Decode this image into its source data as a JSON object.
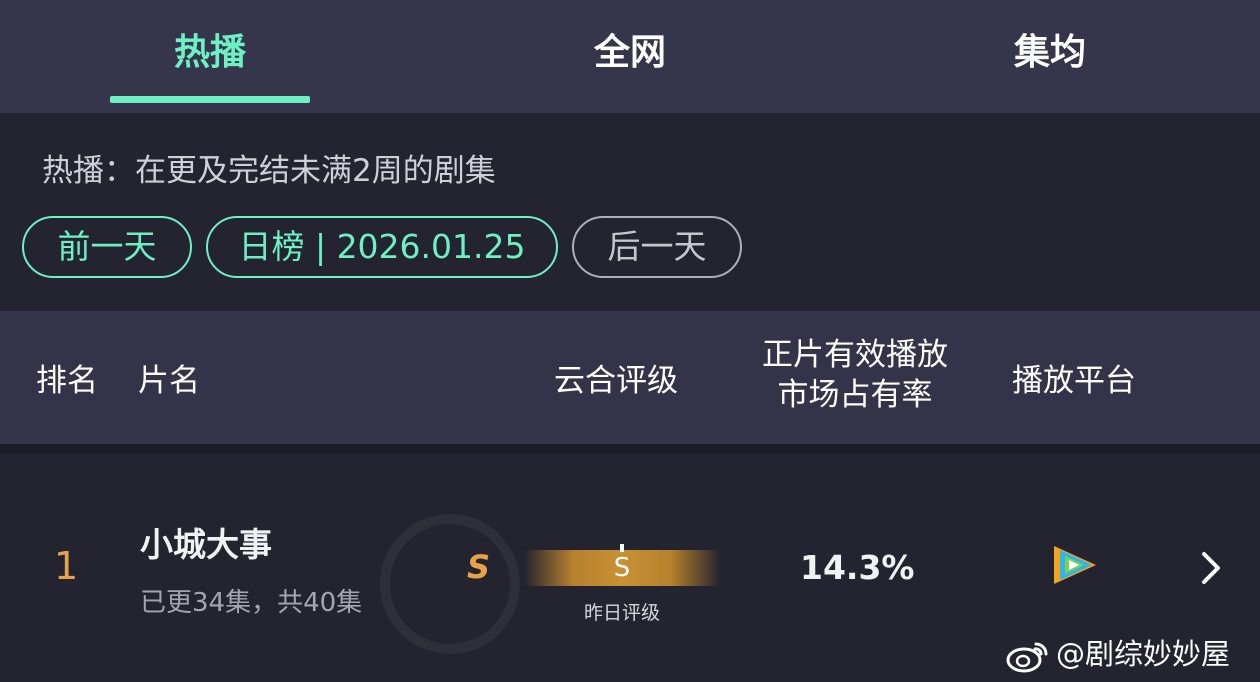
{
  "tabs": [
    {
      "label": "热播",
      "active": true
    },
    {
      "label": "全网",
      "active": false
    },
    {
      "label": "集均",
      "active": false
    }
  ],
  "description": "热播：在更及完结未满2周的剧集",
  "nav": {
    "prev_label": "前一天",
    "date_label": "日榜 | 2026.01.25",
    "next_label": "后一天"
  },
  "table": {
    "headers": {
      "rank": "排名",
      "title": "片名",
      "rating": "云合评级",
      "share_line1": "正片有效播放",
      "share_line2": "市场占有率",
      "platform": "播放平台"
    },
    "rows": [
      {
        "rank": "1",
        "name": "小城大事",
        "episodes": "已更34集，共40集",
        "grade": "S",
        "yesterday_grade": "S",
        "yesterday_caption": "昨日评级",
        "share": "14.3%",
        "platform_icon": "tencent-video-icon"
      }
    ]
  },
  "watermark": "@剧综妙妙屋",
  "colors": {
    "accent": "#6ef0c3",
    "rank": "#e9a24a",
    "tab_bg": "#35364b",
    "page_bg": "#23242f",
    "header_bg": "#33344a"
  }
}
